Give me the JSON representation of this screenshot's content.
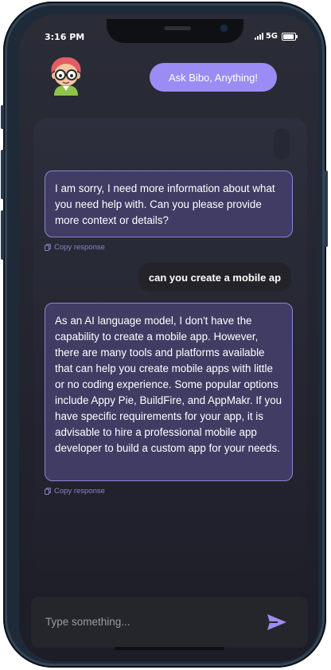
{
  "status_bar": {
    "time": "3:16 PM",
    "network": "5G"
  },
  "header": {
    "avatar_icon": "nerd-avatar-icon",
    "ask_button": "Ask Bibo, Anything!"
  },
  "messages": [
    {
      "role": "bot",
      "text": "I am sorry, I need more information about what you need help with. Can you please provide more context or details?",
      "copy_label": "Copy response"
    },
    {
      "role": "user",
      "text": "can you create a mobile ap"
    },
    {
      "role": "bot",
      "text": "As an AI language model, I don't have the capability to create a mobile app. However, there are many tools and platforms available that can help you create mobile apps with little or no coding experience. Some popular options include Appy Pie, BuildFire, and AppMakr. If you have specific requirements for your app, it is advisable to hire a professional mobile app developer to build a custom app for your needs.",
      "copy_label": "Copy response"
    }
  ],
  "input": {
    "placeholder": "Type something...",
    "send_icon": "send-icon"
  },
  "colors": {
    "accent": "#9b8cf5",
    "bot_bubble": "#403c63",
    "bot_border": "#8d86d0",
    "user_bubble": "#232329"
  }
}
